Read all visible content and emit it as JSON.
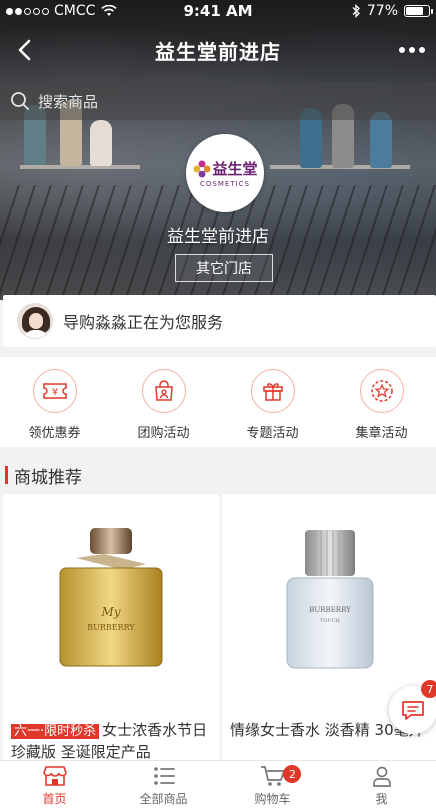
{
  "status_bar": {
    "carrier": "CMCC",
    "time": "9:41 AM",
    "battery": "77%",
    "battery_level": 0.77
  },
  "nav": {
    "title": "益生堂前进店",
    "back_icon": "chevron-left-icon",
    "more_icon": "more-dots-icon"
  },
  "search": {
    "placeholder": "搜索商品"
  },
  "store": {
    "logo_text": "益生堂",
    "logo_sub": "COSMETICS",
    "name": "益生堂前进店",
    "other_stores_label": "其它门店"
  },
  "guide": {
    "text": "导购淼淼正在为您服务"
  },
  "actions": [
    {
      "label": "领优惠券",
      "icon": "coupon-icon"
    },
    {
      "label": "团购活动",
      "icon": "group-buy-icon"
    },
    {
      "label": "专题活动",
      "icon": "gift-icon"
    },
    {
      "label": "集章活动",
      "icon": "stamp-icon"
    }
  ],
  "section": {
    "title": "商城推荐"
  },
  "products": [
    {
      "tag": "六一·限时秒杀",
      "title": "女士浓香水节日珍藏版 圣诞限定产品"
    },
    {
      "title": "情缘女士香水 淡香精 30毫升"
    }
  ],
  "chat": {
    "badge": "7"
  },
  "tabbar": [
    {
      "label": "首页",
      "icon": "shop-home-icon",
      "active": true
    },
    {
      "label": "全部商品",
      "icon": "list-icon"
    },
    {
      "label": "购物车",
      "icon": "cart-icon",
      "badge": "2"
    },
    {
      "label": "我",
      "icon": "user-icon"
    }
  ],
  "colors": {
    "accent": "#e0372b",
    "brand_purple": "#6a1f6f"
  }
}
